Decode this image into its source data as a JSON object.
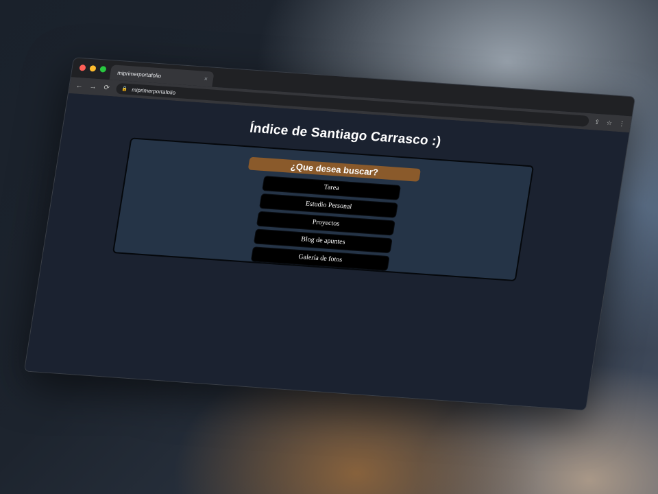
{
  "browser": {
    "tab_title": "miprimerportafolio",
    "tab_close": "×",
    "address": "miprimerportafolio",
    "nav": {
      "back": "←",
      "forward": "→",
      "reload": "⟳"
    },
    "icons": {
      "lock": "🔒",
      "share": "⇪",
      "star": "☆",
      "menu": "⋮"
    }
  },
  "page": {
    "title": "Índice de Santiago Carrasco :)",
    "search_heading": "¿Que desea buscar?",
    "menu_items": [
      {
        "label": "Tarea"
      },
      {
        "label": "Estudio Personal"
      },
      {
        "label": "Proyectos"
      },
      {
        "label": "Blog de apuntes"
      },
      {
        "label": "Galería de fotos"
      }
    ]
  },
  "colors": {
    "page_bg": "#1b2230",
    "card_bg": "#253447",
    "banner_bg": "#8a5a2b",
    "menu_item_bg": "#000000"
  }
}
